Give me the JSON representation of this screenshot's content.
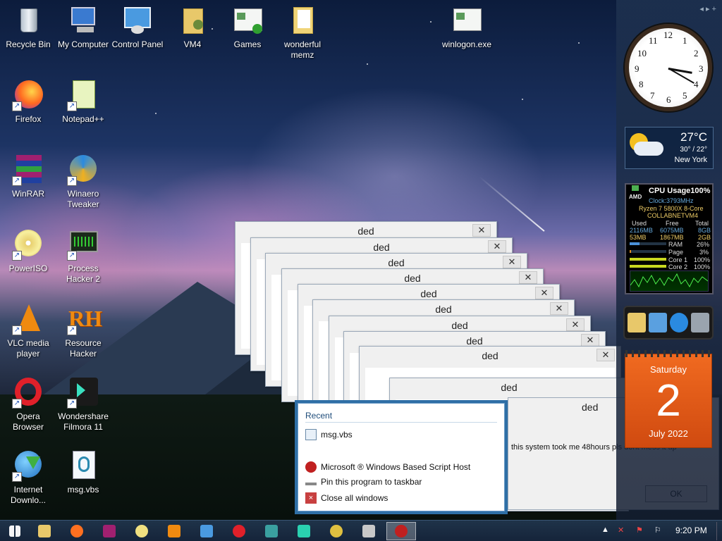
{
  "desktop": {
    "icons": [
      {
        "label": "Recycle Bin"
      },
      {
        "label": "My Computer"
      },
      {
        "label": "Control Panel"
      },
      {
        "label": "VM4"
      },
      {
        "label": "Games"
      },
      {
        "label": "wonderful memz"
      },
      {
        "label": "winlogon.exe"
      },
      {
        "label": "Firefox"
      },
      {
        "label": "Notepad++"
      },
      {
        "label": "WinRAR"
      },
      {
        "label": "Winaero Tweaker"
      },
      {
        "label": "PowerISO"
      },
      {
        "label": "Process Hacker 2"
      },
      {
        "label": "VLC media player"
      },
      {
        "label": "Resource Hacker"
      },
      {
        "label": "Opera Browser"
      },
      {
        "label": "Wondershare Filmora 11"
      },
      {
        "label": "Internet Downlo..."
      },
      {
        "label": "msg.vbs"
      }
    ]
  },
  "gadgets": {
    "sidebar_controls": "◂ ▸ +",
    "clock_numbers": [
      "12",
      "1",
      "2",
      "3",
      "4",
      "5",
      "6",
      "7",
      "8",
      "9",
      "10",
      "11"
    ],
    "weather": {
      "temp": "27°C",
      "range": "30° / 22°",
      "city": "New York"
    },
    "cpu": {
      "title": "CPU Usage100%",
      "brand": "AMD",
      "clock": "Clock:3793MHz",
      "model": "Ryzen 7 5800X 8-Core",
      "host": "COLLABNETVM4",
      "headers": [
        "Used",
        "Free",
        "Total"
      ],
      "ram_row": [
        "2116MB",
        "6075MB",
        "8GB"
      ],
      "page_row": [
        "53MB",
        "1867MB",
        "2GB"
      ],
      "meters": [
        {
          "label": "RAM",
          "value": "26%",
          "fill": 26,
          "color": "#4a90d8"
        },
        {
          "label": "Page",
          "value": "3%",
          "fill": 3,
          "color": "#e08a20"
        },
        {
          "label": "Core 1",
          "value": "100%",
          "fill": 100,
          "color": "#c8d820"
        },
        {
          "label": "Core 2",
          "value": "100%",
          "fill": 100,
          "color": "#c8d820"
        }
      ]
    },
    "calendar": {
      "weekday": "Saturday",
      "day": "2",
      "month_year": "July 2022"
    }
  },
  "dialogs": {
    "title": "ded",
    "close": "✕",
    "front_message": "this system took me 48hours pls dont mess it up",
    "ok_label": "OK"
  },
  "jumplist": {
    "header": "Recent",
    "recent_item": "msg.vbs",
    "task_item": "Microsoft ® Windows Based Script Host",
    "pin_item": "Pin this program to taskbar",
    "close_item": "Close all windows"
  },
  "taskbar": {
    "time": "9:20 PM"
  }
}
